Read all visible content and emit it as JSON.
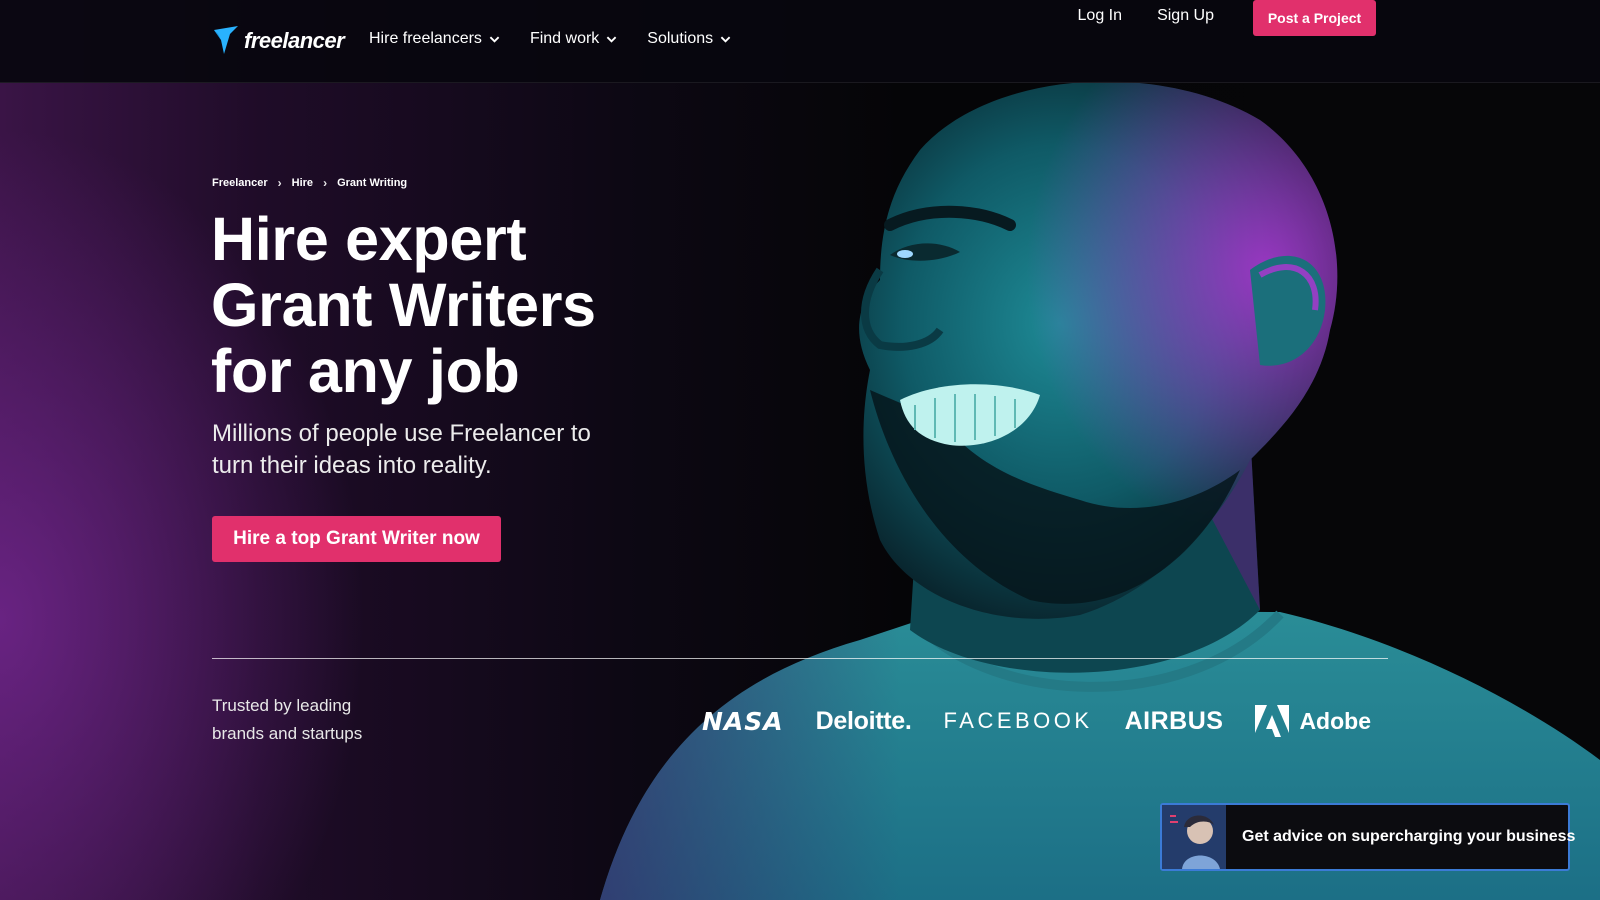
{
  "header": {
    "logo_text": "freelancer",
    "nav": [
      {
        "label": "Hire freelancers"
      },
      {
        "label": "Find work"
      },
      {
        "label": "Solutions"
      }
    ],
    "login_label": "Log In",
    "signup_label": "Sign Up",
    "post_project_label": "Post a Project"
  },
  "breadcrumb": [
    "Freelancer",
    "Hire",
    "Grant Writing"
  ],
  "hero": {
    "title_lines": [
      "Hire expert",
      "Grant Writers",
      "for any job"
    ],
    "subtitle_lines": [
      "Millions of people use Freelancer to",
      "turn their ideas into reality."
    ],
    "cta_label": "Hire a top Grant Writer now"
  },
  "trusted": {
    "lines": [
      "Trusted by leading",
      "brands and startups"
    ],
    "brands": [
      "NASA",
      "Deloitte.",
      "FACEBOOK",
      "AIRBUS",
      "Adobe"
    ]
  },
  "advice_chip": {
    "label": "Get advice on supercharging your business"
  },
  "colors": {
    "accent": "#e1306c",
    "chip_border": "#3b7bd6",
    "logo_blue": "#29b2fe"
  },
  "icons": {
    "nav_chevron": "chevron-down-icon",
    "breadcrumb_separator": "chevron-right-icon",
    "logo": "freelancer-bird-icon"
  }
}
